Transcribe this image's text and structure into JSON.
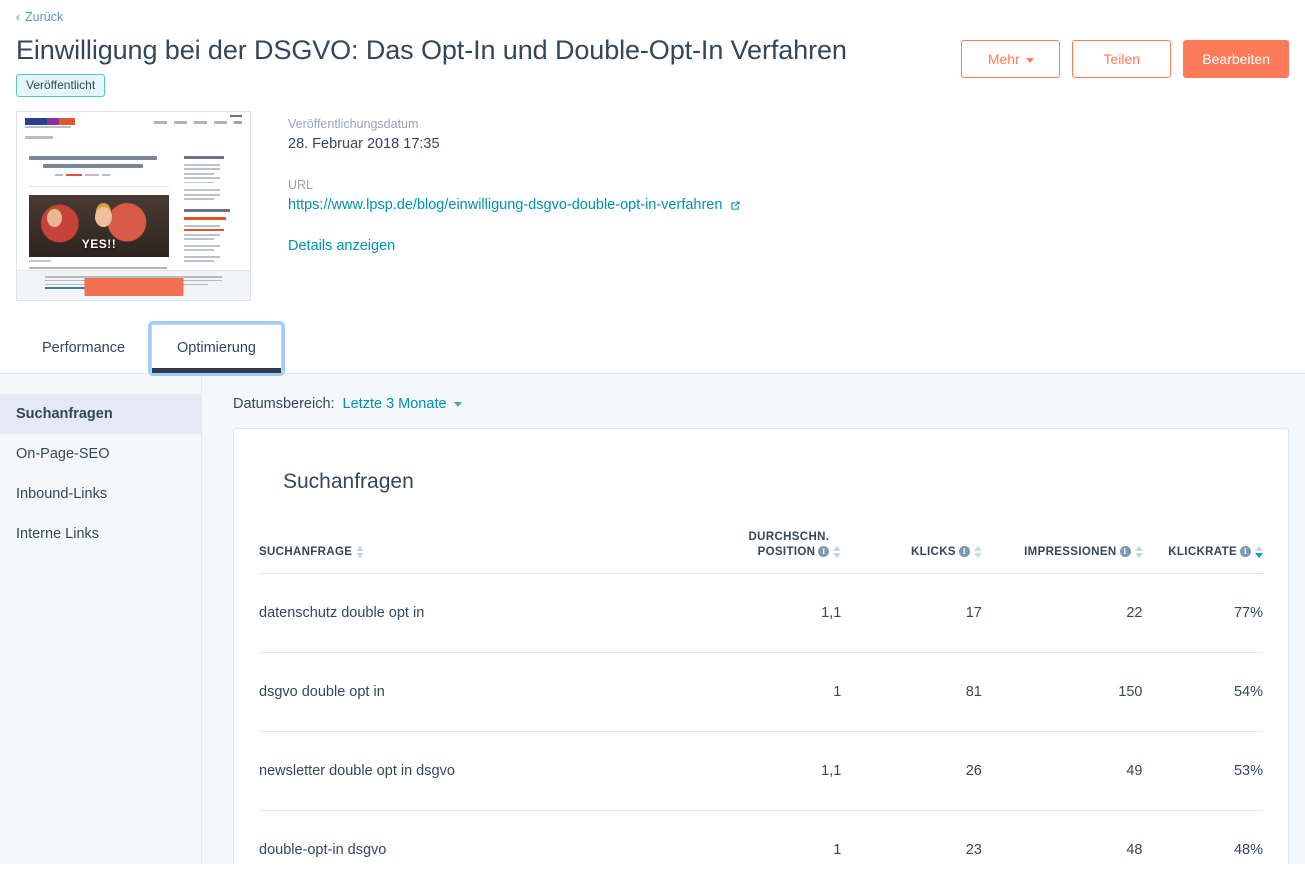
{
  "header": {
    "back_label": "Zurück",
    "title": "Einwilligung bei der DSGVO: Das Opt-In und Double-Opt-In Verfahren",
    "status_badge": "Veröffentlicht",
    "buttons": {
      "more": "Mehr",
      "share": "Teilen",
      "edit": "Bearbeiten"
    }
  },
  "meta": {
    "publish_label": "Veröffentlichungsdatum",
    "publish_value": "28. Februar 2018 17:35",
    "url_label": "URL",
    "url_value": "https://www.lpsp.de/blog/einwilligung-dsgvo-double-opt-in-verfahren",
    "details_link": "Details anzeigen",
    "thumbnail_caption": "YES!!"
  },
  "tabs": [
    {
      "label": "Performance",
      "active": false
    },
    {
      "label": "Optimierung",
      "active": true
    }
  ],
  "sidebar": {
    "items": [
      {
        "label": "Suchanfragen",
        "active": true
      },
      {
        "label": "On-Page-SEO",
        "active": false
      },
      {
        "label": "Inbound-Links",
        "active": false
      },
      {
        "label": "Interne Links",
        "active": false
      }
    ]
  },
  "daterange": {
    "label": "Datumsbereich:",
    "value": "Letzte 3 Monate"
  },
  "panel": {
    "title": "Suchanfragen",
    "columns": [
      {
        "label": "SUCHANFRAGE",
        "info": false,
        "sort": "none"
      },
      {
        "label": "DURCHSCHN.",
        "label2": "POSITION",
        "info": true,
        "sort": "none"
      },
      {
        "label": "KLICKS",
        "info": true,
        "sort": "none"
      },
      {
        "label": "IMPRESSIONEN",
        "info": true,
        "sort": "none"
      },
      {
        "label": "KLICKRATE",
        "info": true,
        "sort": "desc"
      }
    ],
    "rows": [
      {
        "query": "datenschutz double opt in",
        "position": "1,1",
        "clicks": "17",
        "impressions": "22",
        "ctr": "77%"
      },
      {
        "query": "dsgvo double opt in",
        "position": "1",
        "clicks": "81",
        "impressions": "150",
        "ctr": "54%"
      },
      {
        "query": "newsletter double opt in dsgvo",
        "position": "1,1",
        "clicks": "26",
        "impressions": "49",
        "ctr": "53%"
      },
      {
        "query": "double-opt-in dsgvo",
        "position": "1",
        "clicks": "23",
        "impressions": "48",
        "ctr": "48%"
      }
    ]
  },
  "colors": {
    "brand_orange": "#ff7a59",
    "link_teal": "#0091ae",
    "text_dark": "#33475b",
    "bg_panel": "#f5f8fa",
    "badge_border": "#5ec6b6",
    "sort_active": "#00a4bd"
  }
}
